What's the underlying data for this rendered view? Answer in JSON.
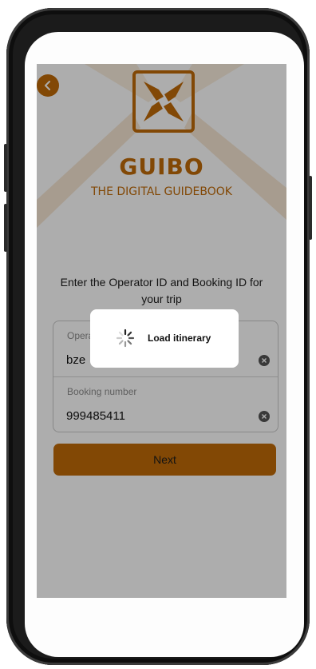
{
  "app": {
    "brand_name": "GUIBO",
    "brand_tagline": "THE DIGITAL GUIDEBOOK",
    "accent_color": "#c06a08",
    "back_icon": "chevron-left-icon",
    "logo_icon": "guibo-x-logo"
  },
  "form": {
    "instruction": "Enter the Operator ID and Booking ID for your trip",
    "operator_field": {
      "label": "Operator ID",
      "value": "bze"
    },
    "booking_field": {
      "label": "Booking number",
      "value": "999485411"
    },
    "clear_icon": "clear-circle-icon",
    "next_label": "Next"
  },
  "loading_dialog": {
    "text": "Load itinerary",
    "icon": "spinner-icon"
  }
}
